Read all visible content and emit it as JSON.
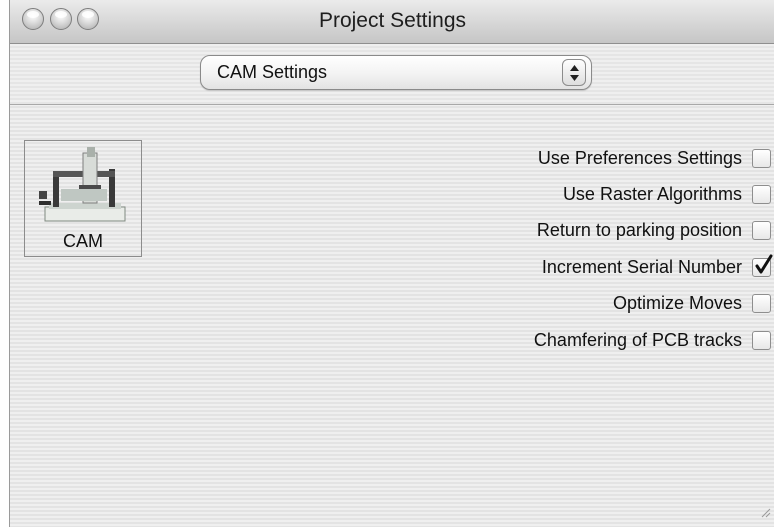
{
  "window": {
    "title": "Project Settings",
    "buttons": [
      "close",
      "minimize",
      "zoom"
    ]
  },
  "toolbar": {
    "popup_value": "CAM Settings",
    "popup_icon": "up-down-arrows-icon"
  },
  "sidebar": {
    "items": [
      {
        "label": "CAM",
        "icon": "cnc-machine-icon",
        "selected": true
      }
    ]
  },
  "options": [
    {
      "label": "Use Preferences Settings",
      "checked": false
    },
    {
      "label": "Use Raster Algorithms",
      "checked": false
    },
    {
      "label": "Return to parking position",
      "checked": false
    },
    {
      "label": "Increment Serial Number",
      "checked": true
    },
    {
      "label": "Optimize Moves",
      "checked": false
    },
    {
      "label": "Chamfering of PCB tracks",
      "checked": false
    }
  ],
  "colors": {
    "window_bg": "#ececec",
    "titlebar_bg": "#d6d6d6",
    "text": "#111111"
  }
}
